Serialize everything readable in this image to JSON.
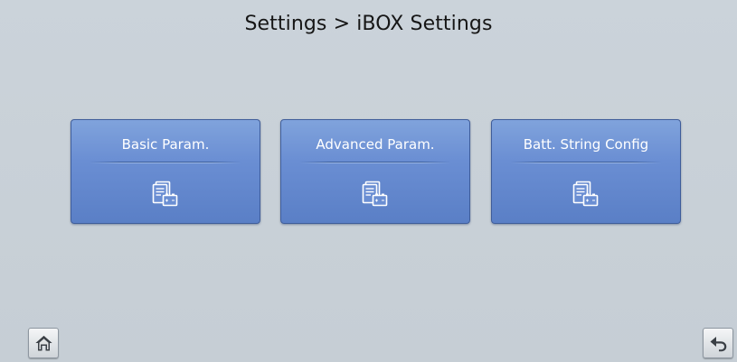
{
  "header": {
    "title": "Settings > iBOX Settings"
  },
  "tiles": [
    {
      "label": "Basic Param.",
      "icon": "parameter-document-battery-icon"
    },
    {
      "label": "Advanced Param.",
      "icon": "parameter-document-battery-icon"
    },
    {
      "label": "Batt. String Config",
      "icon": "parameter-document-battery-icon"
    }
  ],
  "footer": {
    "home_icon": "home-icon",
    "back_icon": "back-arrow-icon"
  },
  "colors": {
    "background": "#c9d1d8",
    "tile_top": "#80a3dc",
    "tile_bottom": "#5a7fc6",
    "tile_border": "#3f5d9a"
  }
}
